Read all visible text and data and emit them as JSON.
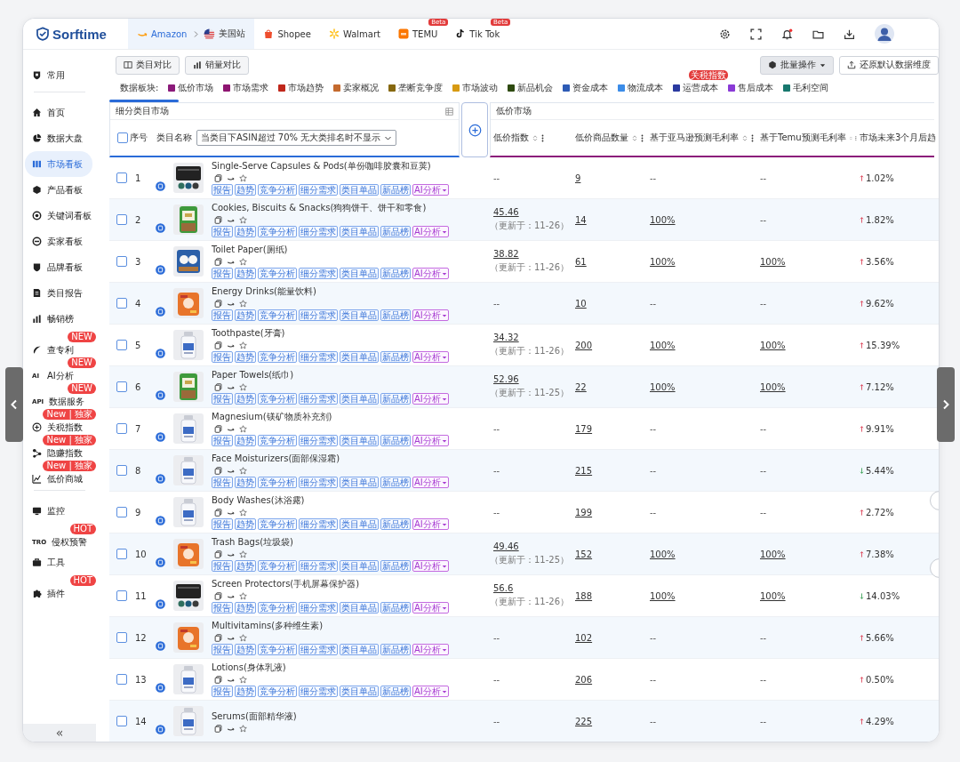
{
  "brand": {
    "name": "Sorftime"
  },
  "platform_tabs": [
    {
      "label": "Amazon",
      "selected": true,
      "site": "美国站"
    },
    {
      "label": "Shopee",
      "selected": false
    },
    {
      "label": "Walmart",
      "selected": false
    },
    {
      "label": "TEMU",
      "selected": false,
      "badge": "Beta"
    },
    {
      "label": "Tik Tok",
      "selected": false,
      "badge": "Beta"
    }
  ],
  "header_tools": {
    "notification_dot": true
  },
  "sidebar": {
    "groups": [
      {
        "items": [
          {
            "label": "常用",
            "selected": false
          }
        ]
      },
      {
        "items": [
          {
            "label": "首页",
            "selected": false
          },
          {
            "label": "数据大盘",
            "selected": false
          },
          {
            "label": "市场看板",
            "selected": true
          },
          {
            "label": "产品看板",
            "selected": false
          },
          {
            "label": "关键词看板",
            "selected": false
          },
          {
            "label": "卖家看板",
            "selected": false
          },
          {
            "label": "品牌看板",
            "selected": false
          },
          {
            "label": "类目报告",
            "selected": false
          },
          {
            "label": "畅销榜",
            "selected": false
          },
          {
            "label": "查专利",
            "selected": false,
            "badge": "NEW"
          },
          {
            "label": "AI分析",
            "icon_text": "AI",
            "selected": false,
            "badge": "NEW"
          },
          {
            "label": "数据服务",
            "icon_text": "API",
            "selected": false,
            "badge": "NEW"
          },
          {
            "label": "关税指数",
            "selected": false,
            "badge": "New | 独家"
          },
          {
            "label": "隐赚指数",
            "selected": false,
            "badge": "New | 独家"
          },
          {
            "label": "低价商城",
            "selected": false,
            "badge": "New | 独家"
          }
        ]
      },
      {
        "items": [
          {
            "label": "监控",
            "selected": false
          },
          {
            "label": "侵权预警",
            "icon_text": "TRO",
            "selected": false,
            "badge": "HOT"
          },
          {
            "label": "工具",
            "selected": false
          },
          {
            "label": "插件",
            "selected": false,
            "badge": "HOT"
          }
        ]
      }
    ],
    "collapse": "«"
  },
  "toolbar": {
    "compare_buttons": [
      "类目对比",
      "销量对比"
    ],
    "batch_button": "批量操作",
    "reset_button": "还原默认数据维度"
  },
  "legend": {
    "label": "数据板块:",
    "items": [
      {
        "label": "低价市场",
        "color": "#8b1a7a"
      },
      {
        "label": "市场需求",
        "color": "#8e1571"
      },
      {
        "label": "市场趋势",
        "color": "#c0271b"
      },
      {
        "label": "卖家概况",
        "color": "#c46a2e"
      },
      {
        "label": "垄断竞争度",
        "color": "#86680f"
      },
      {
        "label": "市场波动",
        "color": "#d79a12"
      },
      {
        "label": "新品机会",
        "color": "#2e4a10"
      },
      {
        "label": "资金成本",
        "color": "#2d5bb5"
      },
      {
        "label": "物流成本",
        "color": "#3b8ce8"
      },
      {
        "label": "运营成本",
        "color": "#2a3aa0",
        "badge": "关税指数"
      },
      {
        "label": "售后成本",
        "color": "#8a3ad6"
      },
      {
        "label": "毛利空间",
        "color": "#17786e"
      }
    ]
  },
  "table": {
    "left_panel": {
      "title": "细分类目市场",
      "header_checked": false,
      "index_header": "序号",
      "name_header": "类目名称",
      "filter": "当类目下ASIN超过 70% 无大类排名时不显示"
    },
    "right_panel": {
      "title": "低价市场",
      "columns": [
        {
          "label": "低价指数",
          "sortable": true
        },
        {
          "label": "低价商品数量",
          "sortable": true
        },
        {
          "label": "基于亚马逊预测毛利率",
          "sortable": true
        },
        {
          "label": "基于Temu预测毛利率",
          "sortable": true
        },
        {
          "label": "市场未来3个月后趋",
          "sortable": false
        }
      ]
    },
    "rows": [
      {
        "index": "1",
        "name": "Single-Serve Capsules & Pods(单份咖啡胶囊和豆荚)",
        "checked": false,
        "starred": false,
        "tags": [
          "报告",
          "趋势",
          "竞争分析",
          "细分需求",
          "类目单品",
          "新品榜"
        ],
        "ai_menu": "AI分析",
        "cells": [
          {
            "text": "--",
            "link": false
          },
          {
            "text": "9",
            "link": true
          },
          {
            "text": "--",
            "link": false
          },
          {
            "text": "--",
            "link": false
          }
        ],
        "trend": {
          "kind": "up",
          "text": "1.02%"
        }
      },
      {
        "index": "2",
        "name": "Cookies, Biscuits & Snacks(狗狗饼干、饼干和零食)",
        "checked": false,
        "starred": false,
        "tags": [
          "报告",
          "趋势",
          "竞争分析",
          "细分需求",
          "类目单品",
          "新品榜"
        ],
        "ai_menu": "AI分析",
        "cells": [
          {
            "text": "45.46",
            "link": true,
            "note": "（更新于：11-26）"
          },
          {
            "text": "14",
            "link": true
          },
          {
            "text": "100%",
            "link": true
          },
          {
            "text": "--",
            "link": false
          }
        ],
        "trend": {
          "kind": "up",
          "text": "1.82%"
        }
      },
      {
        "index": "3",
        "name": "Toilet Paper(厕纸)",
        "checked": false,
        "starred": false,
        "tags": [
          "报告",
          "趋势",
          "竞争分析",
          "细分需求",
          "类目单品",
          "新品榜"
        ],
        "ai_menu": "AI分析",
        "cells": [
          {
            "text": "38.82",
            "link": true,
            "note": "（更新于：11-26）"
          },
          {
            "text": "61",
            "link": true
          },
          {
            "text": "100%",
            "link": true
          },
          {
            "text": "100%",
            "link": true
          }
        ],
        "trend": {
          "kind": "up",
          "text": "3.56%"
        }
      },
      {
        "index": "4",
        "name": "Energy Drinks(能量饮料)",
        "checked": false,
        "starred": false,
        "tags": [
          "报告",
          "趋势",
          "竞争分析",
          "细分需求",
          "类目单品",
          "新品榜"
        ],
        "ai_menu": "AI分析",
        "cells": [
          {
            "text": "--",
            "link": false
          },
          {
            "text": "10",
            "link": true
          },
          {
            "text": "--",
            "link": false
          },
          {
            "text": "--",
            "link": false
          }
        ],
        "trend": {
          "kind": "up",
          "text": "9.62%"
        }
      },
      {
        "index": "5",
        "name": "Toothpaste(牙膏)",
        "checked": false,
        "starred": false,
        "tags": [
          "报告",
          "趋势",
          "竞争分析",
          "细分需求",
          "类目单品",
          "新品榜"
        ],
        "ai_menu": "AI分析",
        "cells": [
          {
            "text": "34.32",
            "link": true,
            "note": "（更新于：11-26）"
          },
          {
            "text": "200",
            "link": true
          },
          {
            "text": "100%",
            "link": true
          },
          {
            "text": "100%",
            "link": true
          }
        ],
        "trend": {
          "kind": "up",
          "text": "15.39%"
        }
      },
      {
        "index": "6",
        "name": "Paper Towels(纸巾)",
        "checked": false,
        "starred": false,
        "tags": [
          "报告",
          "趋势",
          "竞争分析",
          "细分需求",
          "类目单品",
          "新品榜"
        ],
        "ai_menu": "AI分析",
        "cells": [
          {
            "text": "52.96",
            "link": true,
            "note": "（更新于：11-25）"
          },
          {
            "text": "22",
            "link": true
          },
          {
            "text": "100%",
            "link": true
          },
          {
            "text": "100%",
            "link": true
          }
        ],
        "trend": {
          "kind": "up",
          "text": "7.12%"
        }
      },
      {
        "index": "7",
        "name": "Magnesium(镁矿物质补充剂)",
        "checked": false,
        "starred": false,
        "tags": [
          "报告",
          "趋势",
          "竞争分析",
          "细分需求",
          "类目单品",
          "新品榜"
        ],
        "ai_menu": "AI分析",
        "cells": [
          {
            "text": "--",
            "link": false
          },
          {
            "text": "179",
            "link": true
          },
          {
            "text": "--",
            "link": false
          },
          {
            "text": "--",
            "link": false
          }
        ],
        "trend": {
          "kind": "up",
          "text": "9.91%"
        }
      },
      {
        "index": "8",
        "name": "Face Moisturizers(面部保湿霜)",
        "checked": false,
        "starred": false,
        "tags": [
          "报告",
          "趋势",
          "竞争分析",
          "细分需求",
          "类目单品",
          "新品榜"
        ],
        "ai_menu": "AI分析",
        "cells": [
          {
            "text": "--",
            "link": false
          },
          {
            "text": "215",
            "link": true
          },
          {
            "text": "--",
            "link": false
          },
          {
            "text": "--",
            "link": false
          }
        ],
        "trend": {
          "kind": "down",
          "text": "5.44%"
        }
      },
      {
        "index": "9",
        "name": "Body Washes(沐浴露)",
        "checked": false,
        "starred": false,
        "tags": [
          "报告",
          "趋势",
          "竞争分析",
          "细分需求",
          "类目单品",
          "新品榜"
        ],
        "ai_menu": "AI分析",
        "cells": [
          {
            "text": "--",
            "link": false
          },
          {
            "text": "199",
            "link": true
          },
          {
            "text": "--",
            "link": false
          },
          {
            "text": "--",
            "link": false
          }
        ],
        "trend": {
          "kind": "up",
          "text": "2.72%"
        }
      },
      {
        "index": "10",
        "name": "Trash Bags(垃圾袋)",
        "checked": false,
        "starred": false,
        "tags": [
          "报告",
          "趋势",
          "竞争分析",
          "细分需求",
          "类目单品",
          "新品榜"
        ],
        "ai_menu": "AI分析",
        "cells": [
          {
            "text": "49.46",
            "link": true,
            "note": "（更新于：11-25）"
          },
          {
            "text": "152",
            "link": true
          },
          {
            "text": "100%",
            "link": true
          },
          {
            "text": "100%",
            "link": true
          }
        ],
        "trend": {
          "kind": "up",
          "text": "7.38%"
        }
      },
      {
        "index": "11",
        "name": "Screen Protectors(手机屏幕保护器)",
        "checked": false,
        "starred": false,
        "tags": [
          "报告",
          "趋势",
          "竞争分析",
          "细分需求",
          "类目单品",
          "新品榜"
        ],
        "ai_menu": "AI分析",
        "cells": [
          {
            "text": "56.6",
            "link": true,
            "note": "（更新于：11-26）"
          },
          {
            "text": "188",
            "link": true
          },
          {
            "text": "100%",
            "link": true
          },
          {
            "text": "100%",
            "link": true
          }
        ],
        "trend": {
          "kind": "down",
          "text": "14.03%"
        }
      },
      {
        "index": "12",
        "name": "Multivitamins(多种维生素)",
        "checked": false,
        "starred": false,
        "tags": [
          "报告",
          "趋势",
          "竞争分析",
          "细分需求",
          "类目单品",
          "新品榜"
        ],
        "ai_menu": "AI分析",
        "cells": [
          {
            "text": "--",
            "link": false
          },
          {
            "text": "102",
            "link": true
          },
          {
            "text": "--",
            "link": false
          },
          {
            "text": "--",
            "link": false
          }
        ],
        "trend": {
          "kind": "up",
          "text": "5.66%"
        }
      },
      {
        "index": "13",
        "name": "Lotions(身体乳液)",
        "checked": false,
        "starred": false,
        "tags": [
          "报告",
          "趋势",
          "竞争分析",
          "细分需求",
          "类目单品",
          "新品榜"
        ],
        "ai_menu": "AI分析",
        "cells": [
          {
            "text": "--",
            "link": false
          },
          {
            "text": "206",
            "link": true
          },
          {
            "text": "--",
            "link": false
          },
          {
            "text": "--",
            "link": false
          }
        ],
        "trend": {
          "kind": "up",
          "text": "0.50%"
        }
      },
      {
        "index": "14",
        "name": "Serums(面部精华液)",
        "checked": false,
        "starred": false,
        "cells": [
          {
            "text": "--",
            "link": false
          },
          {
            "text": "225",
            "link": true
          },
          {
            "text": "--",
            "link": false
          },
          {
            "text": "--",
            "link": false
          }
        ],
        "trend": {
          "kind": "up",
          "text": "4.29%"
        }
      }
    ]
  }
}
